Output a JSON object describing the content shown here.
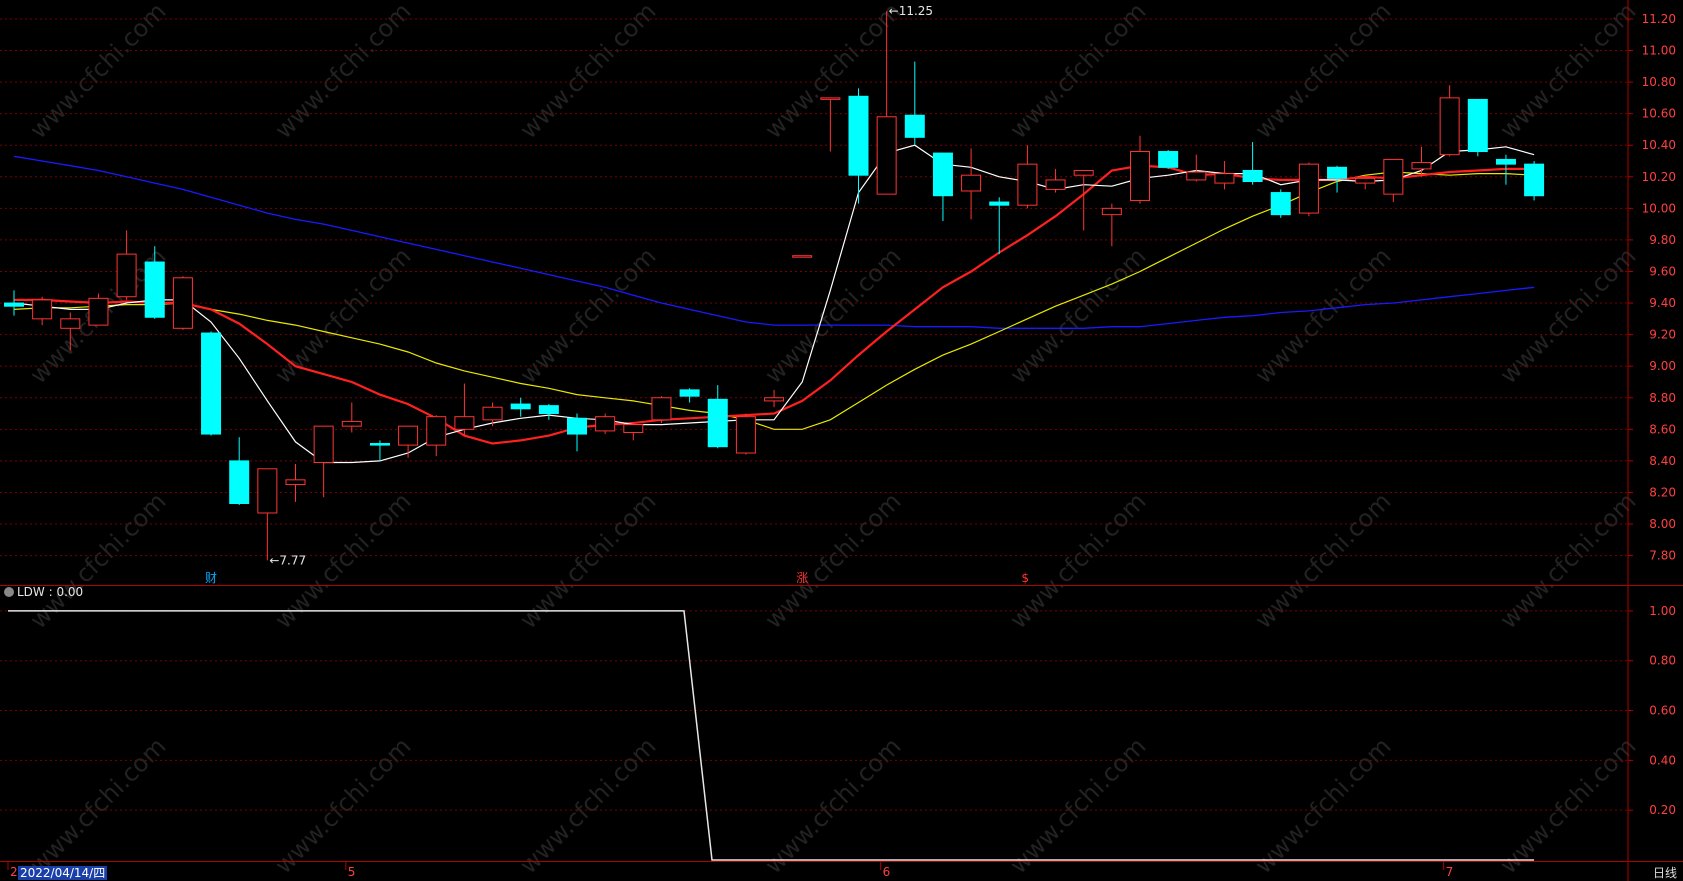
{
  "colors": {
    "up": "#ff3333",
    "down": "#00ffff",
    "ma5": "#ffffff",
    "ma10": "#ff2020",
    "ma20": "#e8e800",
    "ma60": "#1a1aff",
    "grid": "#7a0000",
    "axis_text": "#ff4040",
    "ldw": "#e6e6e6"
  },
  "chart_data": [
    {
      "type": "candlestick",
      "name": "main",
      "ylim": [
        7.62,
        11.32
      ],
      "y_ticks": [
        7.8,
        8.0,
        8.2,
        8.4,
        8.6,
        8.8,
        9.0,
        9.2,
        9.4,
        9.6,
        9.8,
        10.0,
        10.2,
        10.4,
        10.6,
        10.8,
        11.0,
        11.2
      ],
      "y_tick_labels": [
        "7.80",
        "8.00",
        "8.20",
        "8.40",
        "8.60",
        "8.80",
        "9.00",
        "9.20",
        "9.40",
        "9.60",
        "9.80",
        "10.00",
        "10.20",
        "10.40",
        "10.60",
        "10.80",
        "11.00",
        "11.20"
      ],
      "candles": [
        {
          "o": 9.4,
          "h": 9.48,
          "l": 9.32,
          "c": 9.38
        },
        {
          "o": 9.3,
          "h": 9.44,
          "l": 9.26,
          "c": 9.42
        },
        {
          "o": 9.24,
          "h": 9.34,
          "l": 9.1,
          "c": 9.3
        },
        {
          "o": 9.26,
          "h": 9.46,
          "l": 9.26,
          "c": 9.43
        },
        {
          "o": 9.44,
          "h": 9.86,
          "l": 9.42,
          "c": 9.71
        },
        {
          "o": 9.66,
          "h": 9.76,
          "l": 9.3,
          "c": 9.31
        },
        {
          "o": 9.24,
          "h": 9.57,
          "l": 9.23,
          "c": 9.56
        },
        {
          "o": 9.21,
          "h": 9.22,
          "l": 8.56,
          "c": 8.57
        },
        {
          "o": 8.4,
          "h": 8.55,
          "l": 8.12,
          "c": 8.13
        },
        {
          "o": 8.07,
          "h": 8.35,
          "l": 7.77,
          "c": 8.35
        },
        {
          "o": 8.25,
          "h": 8.38,
          "l": 8.14,
          "c": 8.28
        },
        {
          "o": 8.39,
          "h": 8.62,
          "l": 8.17,
          "c": 8.62
        },
        {
          "o": 8.62,
          "h": 8.77,
          "l": 8.58,
          "c": 8.65
        },
        {
          "o": 8.51,
          "h": 8.53,
          "l": 8.4,
          "c": 8.5
        },
        {
          "o": 8.5,
          "h": 8.62,
          "l": 8.42,
          "c": 8.62
        },
        {
          "o": 8.5,
          "h": 8.69,
          "l": 8.43,
          "c": 8.68
        },
        {
          "o": 8.6,
          "h": 8.89,
          "l": 8.56,
          "c": 8.68
        },
        {
          "o": 8.66,
          "h": 8.77,
          "l": 8.62,
          "c": 8.74
        },
        {
          "o": 8.76,
          "h": 8.8,
          "l": 8.68,
          "c": 8.73
        },
        {
          "o": 8.75,
          "h": 8.76,
          "l": 8.66,
          "c": 8.7
        },
        {
          "o": 8.67,
          "h": 8.7,
          "l": 8.46,
          "c": 8.57
        },
        {
          "o": 8.59,
          "h": 8.7,
          "l": 8.57,
          "c": 8.68
        },
        {
          "o": 8.58,
          "h": 8.64,
          "l": 8.53,
          "c": 8.63
        },
        {
          "o": 8.66,
          "h": 8.81,
          "l": 8.64,
          "c": 8.8
        },
        {
          "o": 8.85,
          "h": 8.86,
          "l": 8.77,
          "c": 8.81
        },
        {
          "o": 8.79,
          "h": 8.88,
          "l": 8.48,
          "c": 8.49
        },
        {
          "o": 8.45,
          "h": 8.7,
          "l": 8.44,
          "c": 8.68
        },
        {
          "o": 8.78,
          "h": 8.85,
          "l": 8.74,
          "c": 8.8
        },
        {
          "o": 9.7,
          "h": 9.7,
          "l": 9.69,
          "c": 9.7
        },
        {
          "o": 10.7,
          "h": 10.7,
          "l": 10.36,
          "c": 10.7
        },
        {
          "o": 10.71,
          "h": 10.76,
          "l": 10.03,
          "c": 10.21
        },
        {
          "o": 10.09,
          "h": 11.25,
          "l": 10.09,
          "c": 10.58
        },
        {
          "o": 10.59,
          "h": 10.93,
          "l": 10.4,
          "c": 10.45
        },
        {
          "o": 10.35,
          "h": 10.35,
          "l": 9.92,
          "c": 10.08
        },
        {
          "o": 10.11,
          "h": 10.38,
          "l": 9.93,
          "c": 10.21
        },
        {
          "o": 10.04,
          "h": 10.07,
          "l": 9.71,
          "c": 10.02
        },
        {
          "o": 10.02,
          "h": 10.4,
          "l": 10.0,
          "c": 10.28
        },
        {
          "o": 10.12,
          "h": 10.25,
          "l": 10.1,
          "c": 10.18
        },
        {
          "o": 10.21,
          "h": 10.24,
          "l": 9.86,
          "c": 10.24
        },
        {
          "o": 9.96,
          "h": 10.03,
          "l": 9.76,
          "c": 10.0
        },
        {
          "o": 10.05,
          "h": 10.46,
          "l": 10.03,
          "c": 10.36
        },
        {
          "o": 10.36,
          "h": 10.37,
          "l": 10.25,
          "c": 10.26
        },
        {
          "o": 10.18,
          "h": 10.34,
          "l": 10.17,
          "c": 10.23
        },
        {
          "o": 10.16,
          "h": 10.3,
          "l": 10.12,
          "c": 10.22
        },
        {
          "o": 10.24,
          "h": 10.42,
          "l": 10.15,
          "c": 10.17
        },
        {
          "o": 10.1,
          "h": 10.12,
          "l": 9.94,
          "c": 9.96
        },
        {
          "o": 9.97,
          "h": 10.29,
          "l": 9.95,
          "c": 10.28
        },
        {
          "o": 10.26,
          "h": 10.27,
          "l": 10.1,
          "c": 10.19
        },
        {
          "o": 10.16,
          "h": 10.21,
          "l": 10.12,
          "c": 10.19
        },
        {
          "o": 10.09,
          "h": 10.31,
          "l": 10.04,
          "c": 10.31
        },
        {
          "o": 10.25,
          "h": 10.39,
          "l": 10.2,
          "c": 10.29
        },
        {
          "o": 10.34,
          "h": 10.78,
          "l": 10.33,
          "c": 10.7
        },
        {
          "o": 10.69,
          "h": 10.69,
          "l": 10.33,
          "c": 10.36
        },
        {
          "o": 10.31,
          "h": 10.34,
          "l": 10.15,
          "c": 10.28
        },
        {
          "o": 10.28,
          "h": 10.3,
          "l": 10.05,
          "c": 10.08
        }
      ],
      "ma5": [
        9.4,
        9.38,
        9.36,
        9.36,
        9.4,
        9.42,
        9.42,
        9.28,
        9.05,
        8.78,
        8.52,
        8.39,
        8.39,
        8.4,
        8.45,
        8.55,
        8.6,
        8.64,
        8.67,
        8.69,
        8.67,
        8.66,
        8.63,
        8.63,
        8.64,
        8.65,
        8.66,
        8.66,
        8.9,
        9.48,
        10.1,
        10.35,
        10.4,
        10.28,
        10.26,
        10.2,
        10.17,
        10.12,
        10.15,
        10.14,
        10.19,
        10.21,
        10.24,
        10.22,
        10.22,
        10.15,
        10.18,
        10.18,
        10.17,
        10.18,
        10.24,
        10.36,
        10.37,
        10.39,
        10.34
      ],
      "ma10": [
        9.42,
        9.42,
        9.41,
        9.4,
        9.41,
        9.4,
        9.4,
        9.36,
        9.27,
        9.14,
        9.0,
        8.95,
        8.9,
        8.82,
        8.76,
        8.67,
        8.56,
        8.51,
        8.53,
        8.56,
        8.61,
        8.63,
        8.64,
        8.66,
        8.67,
        8.68,
        8.69,
        8.7,
        8.78,
        8.91,
        9.07,
        9.22,
        9.36,
        9.5,
        9.6,
        9.72,
        9.83,
        9.95,
        10.09,
        10.24,
        10.27,
        10.26,
        10.21,
        10.22,
        10.19,
        10.18,
        10.18,
        10.18,
        10.2,
        10.19,
        10.21,
        10.23,
        10.24,
        10.25,
        10.25
      ],
      "ma20": [
        9.36,
        9.37,
        9.37,
        9.38,
        9.39,
        9.39,
        9.4,
        9.36,
        9.33,
        9.29,
        9.26,
        9.22,
        9.18,
        9.14,
        9.09,
        9.02,
        8.97,
        8.93,
        8.89,
        8.86,
        8.82,
        8.8,
        8.78,
        8.75,
        8.72,
        8.7,
        8.66,
        8.6,
        8.6,
        8.66,
        8.77,
        8.88,
        8.98,
        9.07,
        9.14,
        9.22,
        9.3,
        9.38,
        9.45,
        9.52,
        9.6,
        9.69,
        9.78,
        9.87,
        9.95,
        10.02,
        10.1,
        10.17,
        10.21,
        10.23,
        10.22,
        10.21,
        10.22,
        10.22,
        10.21
      ],
      "ma60": [
        10.33,
        10.3,
        10.27,
        10.24,
        10.2,
        10.16,
        10.12,
        10.07,
        10.02,
        9.97,
        9.93,
        9.9,
        9.86,
        9.82,
        9.78,
        9.74,
        9.7,
        9.66,
        9.62,
        9.58,
        9.54,
        9.5,
        9.45,
        9.4,
        9.36,
        9.32,
        9.28,
        9.26,
        9.26,
        9.26,
        9.26,
        9.26,
        9.25,
        9.25,
        9.25,
        9.24,
        9.24,
        9.24,
        9.24,
        9.25,
        9.25,
        9.27,
        9.29,
        9.31,
        9.32,
        9.34,
        9.35,
        9.37,
        9.39,
        9.4,
        9.42,
        9.44,
        9.46,
        9.48,
        9.5
      ],
      "annotations": [
        {
          "text": "11.25",
          "candle": 31,
          "value": 11.25
        },
        {
          "text": "7.77",
          "candle": 9,
          "value": 7.77
        }
      ],
      "event_markers": [
        {
          "text": "财",
          "candle": 7,
          "color": "#00aaff"
        },
        {
          "text": "涨",
          "candle": 28,
          "color": "#ff3333"
        },
        {
          "text": "$",
          "candle": 36,
          "color": "#ff3333"
        }
      ]
    },
    {
      "type": "line",
      "name": "LDW",
      "ylim": [
        0.0,
        1.1
      ],
      "y_ticks": [
        0.2,
        0.4,
        0.6,
        0.8,
        1.0
      ],
      "y_tick_labels": [
        "0.20",
        "0.40",
        "0.60",
        "0.80",
        "1.00"
      ],
      "series": [
        {
          "name": "LDW",
          "values": [
            1,
            1,
            1,
            1,
            1,
            1,
            1,
            1,
            1,
            1,
            1,
            1,
            1,
            1,
            1,
            1,
            1,
            1,
            1,
            1,
            1,
            1,
            1,
            1,
            1,
            0,
            0,
            0,
            0,
            0,
            0,
            0,
            0,
            0,
            0,
            0,
            0,
            0,
            0,
            0,
            0,
            0,
            0,
            0,
            0,
            0,
            0,
            0,
            0,
            0,
            0,
            0,
            0,
            0,
            0
          ]
        }
      ]
    }
  ],
  "indicator_label": "LDW : 0.00",
  "x_labels": [
    {
      "text": "2",
      "candle": 0
    },
    {
      "text": "5",
      "candle": 12
    },
    {
      "text": "6",
      "candle": 31
    },
    {
      "text": "7",
      "candle": 51
    }
  ],
  "date_cell": "2022/04/14/四",
  "period_label": "日线",
  "watermark": "www.cfchi.com"
}
